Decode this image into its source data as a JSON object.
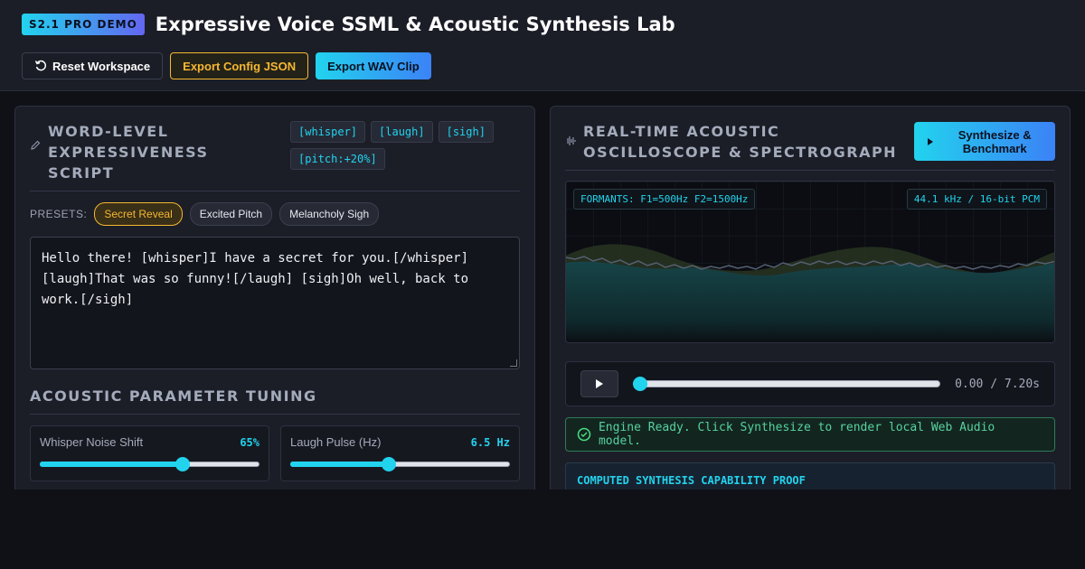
{
  "header": {
    "badge": "S2.1 PRO DEMO",
    "title": "Expressive Voice SSML & Acoustic Synthesis Lab",
    "buttons": {
      "reset": "Reset Workspace",
      "export_json": "Export Config JSON",
      "export_wav": "Export WAV Clip"
    }
  },
  "left": {
    "script_title": "WORD-LEVEL EXPRESSIVENESS SCRIPT",
    "tags": [
      "[whisper]",
      "[laugh]",
      "[sigh]",
      "[pitch:+20%]"
    ],
    "presets_label": "PRESETS:",
    "presets": [
      "Secret Reveal",
      "Excited Pitch",
      "Melancholy Sigh"
    ],
    "active_preset": "Secret Reveal",
    "script_text": "Hello there! [whisper]I have a secret for you.[/whisper] [laugh]That was so funny![/laugh] [sigh]Oh well, back to work.[/sigh]",
    "tuning_title": "ACOUSTIC PARAMETER TUNING",
    "params": [
      {
        "label": "Whisper Noise Shift",
        "value": "65%",
        "level": 0.65
      },
      {
        "label": "Laugh Pulse (Hz)",
        "value": "6.5 Hz",
        "level": 0.45
      }
    ]
  },
  "right": {
    "title": "REAL-TIME ACOUSTIC OSCILLOSCOPE & SPECTROGRAPH",
    "synth_button": "Synthesize & Benchmark",
    "formants": "FORMANTS: F1=500Hz F2=1500Hz",
    "sample_rate": "44.1 kHz / 16-bit PCM",
    "time": "0.00 / 7.20s",
    "playback_level": 0.0,
    "status": "Engine Ready. Click Synthesize to render local Web Audio model.",
    "proof_title": "COMPUTED SYNTHESIS CAPABILITY PROOF"
  },
  "colors": {
    "accent": "#22d3ee",
    "warning": "#f5b731",
    "success": "#4ade80"
  },
  "icons": {
    "reset": "rotate-ccw-icon",
    "edit": "edit-icon",
    "waveform": "waveform-icon",
    "play": "play-icon",
    "check": "check-circle-icon"
  }
}
